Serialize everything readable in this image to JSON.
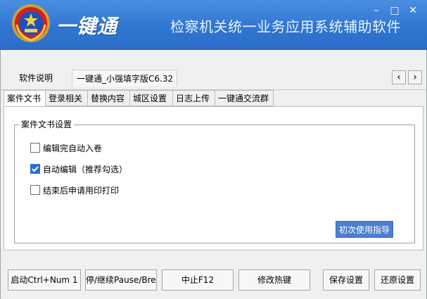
{
  "titlebar": {
    "brand": "一键通",
    "app_title": "检察机关统一业务应用系统辅助软件",
    "minimize": "–",
    "maximize": "□",
    "close": "✕"
  },
  "top_tabs": [
    {
      "label": "软件说明"
    },
    {
      "label": "一键通_小强填字版C6.32"
    }
  ],
  "scroll": {
    "left": "‹",
    "right": "›"
  },
  "sub_tabs": [
    {
      "label": "案件文书"
    },
    {
      "label": "登录相关"
    },
    {
      "label": "替换内容"
    },
    {
      "label": "城区设置"
    },
    {
      "label": "日志上传"
    },
    {
      "label": "一键通交流群"
    }
  ],
  "group": {
    "legend": "案件文书设置",
    "options": [
      {
        "label": "编辑完自动入卷",
        "checked": false
      },
      {
        "label": "自动编辑（推荐勾选）",
        "checked": true
      },
      {
        "label": "结束后申请用印打印",
        "checked": false
      }
    ],
    "guide_button": "初次使用指导"
  },
  "bottom_buttons": [
    {
      "label": "启动Ctrl+Num 1"
    },
    {
      "label": "停/继续Pause/Break"
    },
    {
      "label": "中止F12"
    },
    {
      "label": "修改热键"
    },
    {
      "label": "保存设置"
    },
    {
      "label": "还原设置"
    }
  ],
  "colors": {
    "titlebar": "#2f76d2",
    "accent": "#4b7fd1",
    "check": "#2c6fd2"
  }
}
